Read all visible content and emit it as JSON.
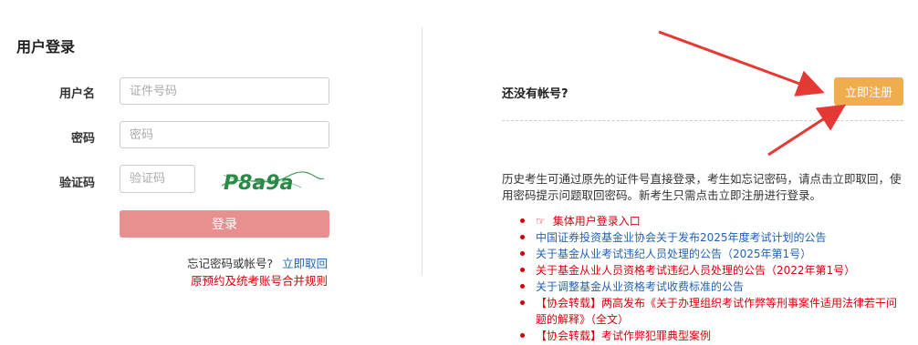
{
  "login": {
    "title": "用户登录",
    "username_label": "用户名",
    "username_placeholder": "证件号码",
    "password_label": "密码",
    "password_placeholder": "密码",
    "captcha_label": "验证码",
    "captcha_placeholder": "验证码",
    "captcha_image_text": "P8a9a",
    "login_button": "登录",
    "forgot_text": "忘记密码或帐号?",
    "forgot_link": "立即取回",
    "merge_rules_link": "原预约及统考账号合并规则"
  },
  "register": {
    "prompt": "还没有帐号?",
    "button": "立即注册",
    "button_color": "#f0ad4e",
    "description": "历史考生可通过原先的证件号直接登录，考生如忘记密码，请点击立即取回，使用密码提示问题取回密码。新考生只需点击立即注册进行登录。"
  },
  "news": [
    {
      "text": "集体用户登录入口",
      "color": "red",
      "icon": "pointing-hand-icon"
    },
    {
      "text": "中国证券投资基金业协会关于发布2025年度考试计划的公告",
      "color": "blue"
    },
    {
      "text": "关于基金从业考试违纪人员处理的公告（2025年第1号）",
      "color": "blue"
    },
    {
      "text": "关于基金从业人员资格考试违纪人员处理的公告（2022年第1号）",
      "color": "red"
    },
    {
      "text": "关于调整基金从业资格考试收费标准的公告",
      "color": "blue"
    },
    {
      "text": "【协会转载】两高发布《关于办理组织考试作弊等刑事案件适用法律若干问题的解释》（全文）",
      "color": "red"
    },
    {
      "text": "【协会转载】考试作弊犯罪典型案例",
      "color": "red"
    }
  ],
  "colors": {
    "login_button": "#e89090",
    "register_button": "#f0ad4e",
    "annotation_arrow": "#e53935",
    "link_blue": "#2463b3",
    "link_red": "#d9000e"
  }
}
